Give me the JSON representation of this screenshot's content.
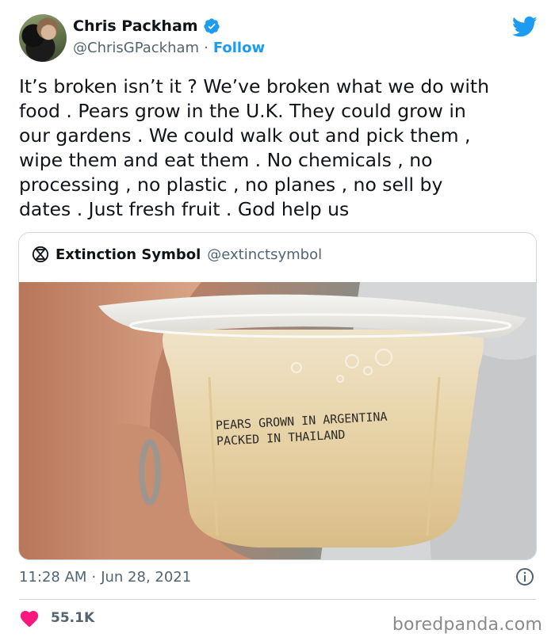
{
  "author": {
    "name": "Chris Packham",
    "handle": "@ChrisGPackham",
    "separator": "·",
    "follow_label": "Follow"
  },
  "tweet": {
    "text": "It’s broken isn’t it ? We’ve broken what we do with\nfood . Pears grow in the U.K. They could grow in\nour gardens . We could walk out and pick them ,\nwipe them and eat them . No chemicals , no\nprocessing , no plastic , no planes , no sell by\ndates . Just fresh fruit . God help us"
  },
  "quoted": {
    "name": "Extinction Symbol",
    "handle": "@extinctsymbol",
    "photo_label_line1": "PEARS GROWN IN ARGENTINA",
    "photo_label_line2": "PACKED IN THAILAND"
  },
  "meta": {
    "time": "11:28 AM",
    "separator": "·",
    "date": "Jun 28, 2021",
    "likes": "55.1K"
  },
  "watermark": "boredpanda.com",
  "colors": {
    "accent": "#1d9bf0",
    "like": "#f91880",
    "secondary_text": "#536471"
  },
  "icons": [
    "verified-badge-icon",
    "twitter-bird-icon",
    "extinction-symbol-icon",
    "info-icon",
    "heart-icon"
  ]
}
